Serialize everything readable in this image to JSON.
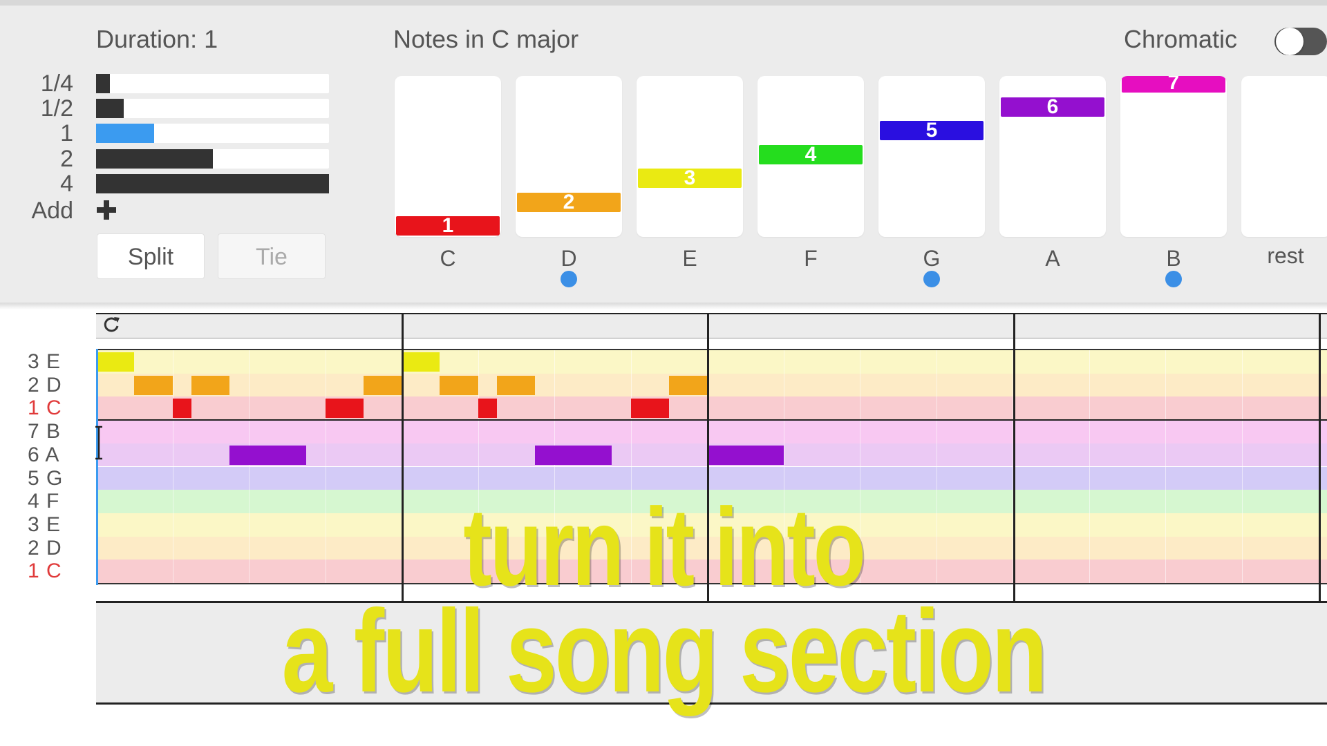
{
  "duration_panel": {
    "title": "Duration: 1",
    "rows": [
      {
        "label": "1/4",
        "fill": 0.06,
        "selected": false
      },
      {
        "label": "1/2",
        "fill": 0.12,
        "selected": false
      },
      {
        "label": "1",
        "fill": 0.25,
        "selected": true
      },
      {
        "label": "2",
        "fill": 0.5,
        "selected": false
      },
      {
        "label": "4",
        "fill": 1.0,
        "selected": false
      }
    ],
    "add_label": "Add",
    "split_label": "Split",
    "tie_label": "Tie"
  },
  "notes_panel": {
    "title": "Notes in C major",
    "chromatic_label": "Chromatic",
    "chromatic_on": false,
    "notes": [
      {
        "degree": "1",
        "name": "C",
        "color": "#e8141b",
        "dot": false
      },
      {
        "degree": "2",
        "name": "D",
        "color": "#f2a51a",
        "dot": true
      },
      {
        "degree": "3",
        "name": "E",
        "color": "#eaea12",
        "dot": false
      },
      {
        "degree": "4",
        "name": "F",
        "color": "#25dd1e",
        "dot": false
      },
      {
        "degree": "5",
        "name": "G",
        "color": "#2a0fe0",
        "dot": true
      },
      {
        "degree": "6",
        "name": "A",
        "color": "#9410cf",
        "dot": false
      },
      {
        "degree": "7",
        "name": "B",
        "color": "#e60ec0",
        "dot": true
      }
    ],
    "rest_label": "rest"
  },
  "piano_roll": {
    "rows": [
      {
        "label": "3 E",
        "tint": "#fbf7c6",
        "red": false
      },
      {
        "label": "2 D",
        "tint": "#fdebc6",
        "red": false
      },
      {
        "label": "1 C",
        "tint": "#f9ccd0",
        "red": true
      },
      {
        "label": "7 B",
        "tint": "#f8c8f2",
        "red": false
      },
      {
        "label": "6 A",
        "tint": "#ebc9f4",
        "red": false
      },
      {
        "label": "5 G",
        "tint": "#d3cbf7",
        "red": false
      },
      {
        "label": "4 F",
        "tint": "#d6f7d0",
        "red": false
      },
      {
        "label": "3 E",
        "tint": "#fbf7c6",
        "red": false
      },
      {
        "label": "2 D",
        "tint": "#fdebc6",
        "red": false
      },
      {
        "label": "1 C",
        "tint": "#f9ccd0",
        "red": true
      }
    ],
    "notes": [
      {
        "row": 0,
        "start": 0.0,
        "length": 0.5,
        "color": "#eaea12"
      },
      {
        "row": 1,
        "start": 0.5,
        "length": 0.5,
        "color": "#f2a51a"
      },
      {
        "row": 1,
        "start": 1.25,
        "length": 0.5,
        "color": "#f2a51a"
      },
      {
        "row": 1,
        "start": 3.5,
        "length": 0.5,
        "color": "#f2a51a"
      },
      {
        "row": 2,
        "start": 1.0,
        "length": 0.25,
        "color": "#e8141b"
      },
      {
        "row": 2,
        "start": 3.0,
        "length": 0.5,
        "color": "#e8141b"
      },
      {
        "row": 4,
        "start": 1.75,
        "length": 1.0,
        "color": "#9410cf"
      },
      {
        "row": 0,
        "start": 4.0,
        "length": 0.5,
        "color": "#eaea12"
      },
      {
        "row": 1,
        "start": 4.5,
        "length": 0.5,
        "color": "#f2a51a"
      },
      {
        "row": 1,
        "start": 5.25,
        "length": 0.5,
        "color": "#f2a51a"
      },
      {
        "row": 1,
        "start": 7.5,
        "length": 0.5,
        "color": "#f2a51a"
      },
      {
        "row": 2,
        "start": 5.0,
        "length": 0.25,
        "color": "#e8141b"
      },
      {
        "row": 2,
        "start": 7.0,
        "length": 0.5,
        "color": "#e8141b"
      },
      {
        "row": 4,
        "start": 5.75,
        "length": 1.0,
        "color": "#9410cf"
      },
      {
        "row": 4,
        "start": 8.0,
        "length": 1.0,
        "color": "#9410cf"
      }
    ]
  },
  "caption": {
    "line1": "turn it into",
    "line2": "a full song section"
  }
}
